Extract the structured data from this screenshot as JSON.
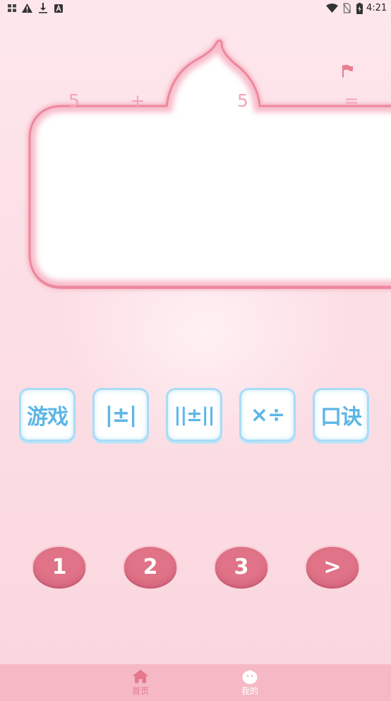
{
  "status_bar": {
    "time": "4:21",
    "left_icons": [
      "app-notification-icon",
      "warning-icon",
      "download-icon",
      "a-box-icon"
    ],
    "right_icons": [
      "wifi-icon",
      "no-sim-icon",
      "battery-charging-icon"
    ]
  },
  "equation": {
    "operand_a": "5",
    "operator": "+",
    "operand_b": "5",
    "equals": "="
  },
  "flag": {
    "icon": "flag-icon"
  },
  "answer_bubble": {
    "value": ""
  },
  "modes": [
    {
      "label": "游戏"
    },
    {
      "label": "|±|"
    },
    {
      "label": "||±||"
    },
    {
      "label": "×÷"
    },
    {
      "label": "口诀"
    }
  ],
  "levels": [
    {
      "label": "1"
    },
    {
      "label": "2"
    },
    {
      "label": "3"
    },
    {
      "label": ">"
    }
  ],
  "bottom_nav": [
    {
      "label": "首页",
      "icon": "home-icon",
      "active": true
    },
    {
      "label": "我的",
      "icon": "face-icon",
      "active": false
    }
  ],
  "colors": {
    "background": "#fde7ec",
    "bubble_outline": "#ee879d",
    "equation_text": "#f3a5b5",
    "mode_text": "#5db6e6",
    "mode_border": "#a9dcf6",
    "level_button": "#e07387",
    "nav_background": "#f5b8c4",
    "nav_active": "#e5788d"
  }
}
